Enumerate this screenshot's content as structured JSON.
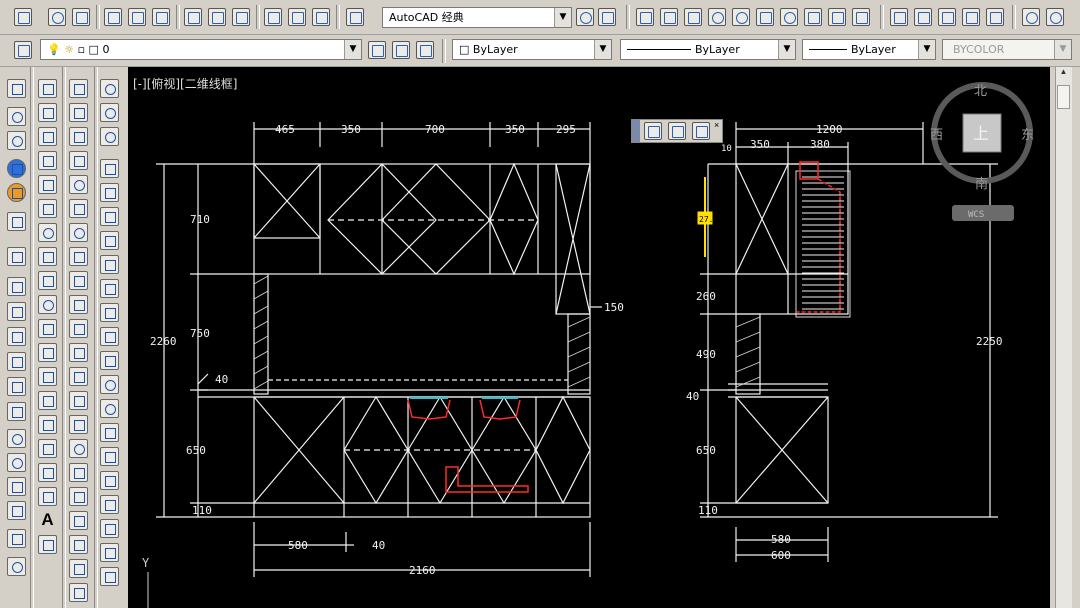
{
  "toolbar1": {
    "workspace": "AutoCAD 经典"
  },
  "toolbar2": {
    "layer": "0",
    "color": "ByLayer",
    "linetype": "ByLayer",
    "lineweight": "ByLayer",
    "plotstyle": "BYCOLOR"
  },
  "viewport": {
    "label": "[-][俯视][二维线框]"
  },
  "viewcube": {
    "north": "北",
    "south": "南",
    "east": "东",
    "west": "西",
    "face": "上",
    "wcs": "WCS"
  },
  "ucs": {
    "y_axis": "Y"
  },
  "drawing": {
    "front_dims": {
      "top_widths": [
        "465",
        "350",
        "700",
        "350",
        "295"
      ],
      "heights_left": [
        "710",
        "750",
        "40",
        "650",
        "110"
      ],
      "overall_height": "2260",
      "bottom_widths": [
        "580",
        "40"
      ],
      "overall_width": "2160",
      "side_gap": "150"
    },
    "side_dims": {
      "top_width": "1200",
      "top_parts": [
        "350",
        "380"
      ],
      "top_small": "10",
      "heights_left": [
        "260",
        "490",
        "40",
        "650",
        "110"
      ],
      "overall_height": "2250",
      "bottom_widths": [
        "580",
        "600"
      ]
    },
    "grip_label": "27.4"
  }
}
